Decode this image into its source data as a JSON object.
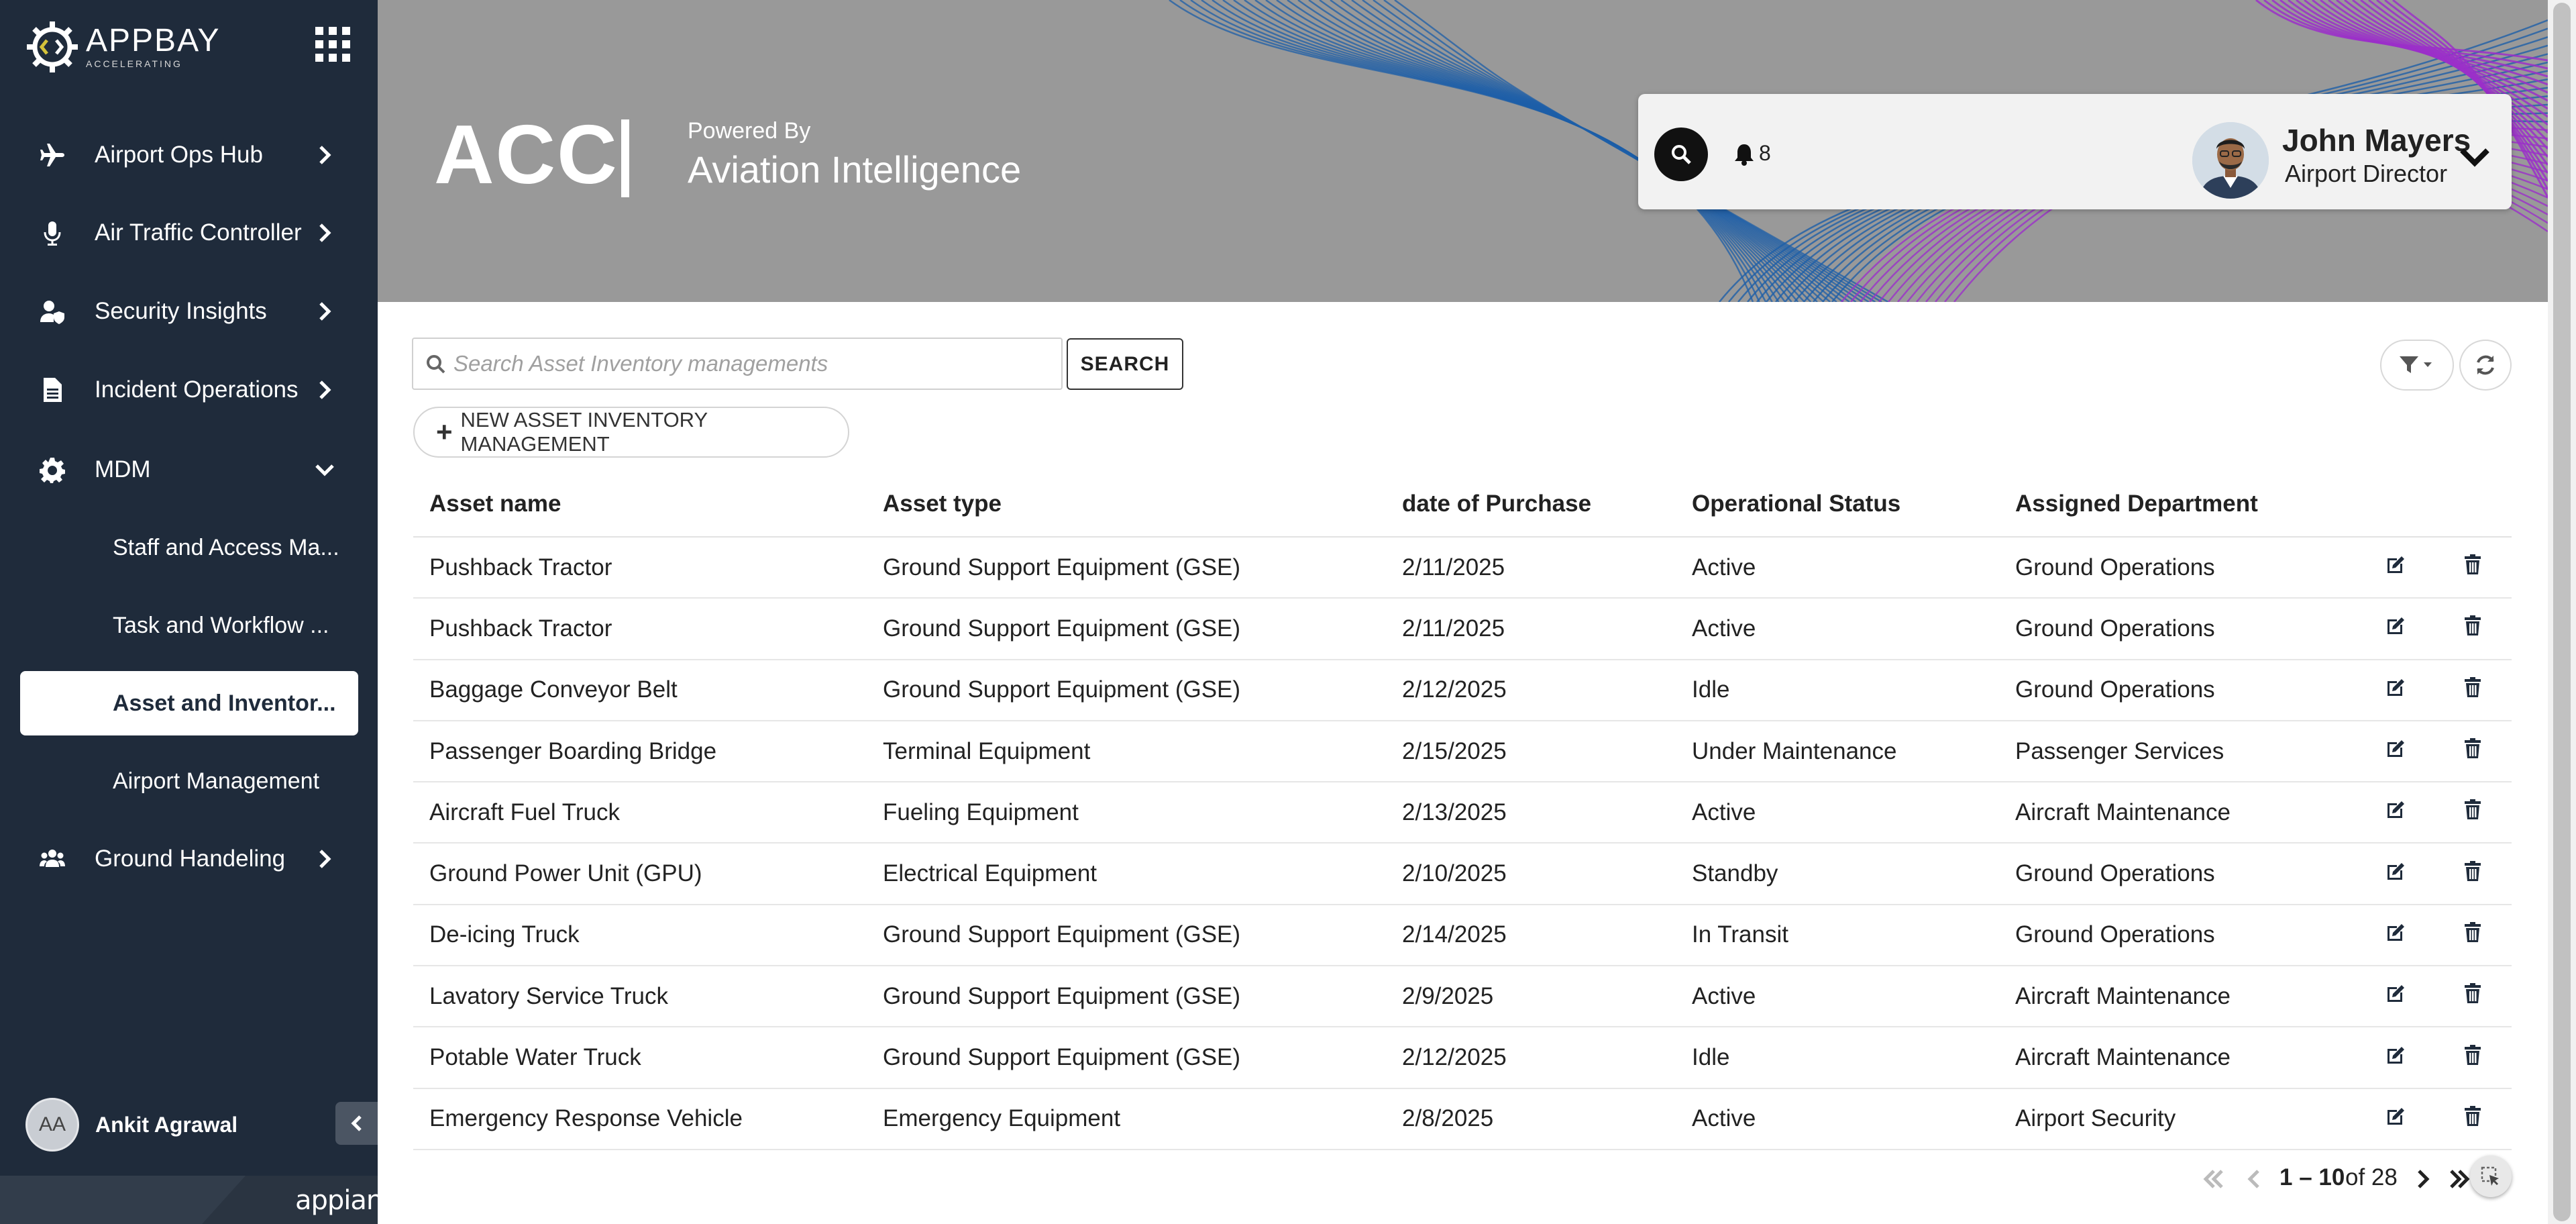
{
  "brand": {
    "name": "APPBAY",
    "tagline": "ACCELERATING"
  },
  "sidebar": {
    "items": [
      {
        "label": "Airport Ops Hub",
        "icon": "plane-icon"
      },
      {
        "label": "Air Traffic Controller",
        "icon": "microphone-icon"
      },
      {
        "label": "Security Insights",
        "icon": "user-shield-icon"
      },
      {
        "label": "Incident Operations",
        "icon": "document-icon"
      },
      {
        "label": "MDM",
        "icon": "gear-icon",
        "expanded": true
      },
      {
        "label": "Ground Handeling",
        "icon": "users-icon"
      }
    ],
    "mdm_sub_items": [
      {
        "label": "Staff and Access Ma..."
      },
      {
        "label": "Task and Workflow ..."
      },
      {
        "label": "Asset and Inventor...",
        "active": true
      },
      {
        "label": "Airport Management"
      }
    ],
    "user": {
      "initials": "AA",
      "name": "Ankit Agrawal"
    },
    "footer_logo": "appian"
  },
  "header": {
    "title": "ACC",
    "powered_by": "Powered By",
    "subtitle": "Aviation Intelligence",
    "notification_count": "8",
    "profile": {
      "name": "John Mayers",
      "role": "Airport Director"
    }
  },
  "toolbar": {
    "search_placeholder": "Search Asset Inventory managements",
    "search_value": "",
    "search_label": "SEARCH",
    "new_label": "NEW ASSET INVENTORY MANAGEMENT"
  },
  "table": {
    "columns": [
      "Asset name",
      "Asset type",
      "date of Purchase",
      "Operational Status",
      "Assigned Department"
    ],
    "rows": [
      [
        "Pushback Tractor",
        "Ground Support Equipment (GSE)",
        "2/11/2025",
        "Active",
        "Ground Operations"
      ],
      [
        "Pushback Tractor",
        "Ground Support Equipment (GSE)",
        "2/11/2025",
        "Active",
        "Ground Operations"
      ],
      [
        "Baggage Conveyor Belt",
        "Ground Support Equipment (GSE)",
        "2/12/2025",
        "Idle",
        "Ground Operations"
      ],
      [
        "Passenger Boarding Bridge",
        "Terminal Equipment",
        "2/15/2025",
        "Under Maintenance",
        "Passenger Services"
      ],
      [
        "Aircraft Fuel Truck",
        "Fueling Equipment",
        "2/13/2025",
        "Active",
        "Aircraft Maintenance"
      ],
      [
        "Ground Power Unit (GPU)",
        "Electrical Equipment",
        "2/10/2025",
        "Standby",
        "Ground Operations"
      ],
      [
        "De-icing Truck",
        "Ground Support Equipment (GSE)",
        "2/14/2025",
        "In Transit",
        "Ground Operations"
      ],
      [
        "Lavatory Service Truck",
        "Ground Support Equipment (GSE)",
        "2/9/2025",
        "Active",
        "Aircraft Maintenance"
      ],
      [
        "Potable Water Truck",
        "Ground Support Equipment (GSE)",
        "2/12/2025",
        "Idle",
        "Aircraft Maintenance"
      ],
      [
        "Emergency Response Vehicle",
        "Emergency Equipment",
        "2/8/2025",
        "Active",
        "Airport Security"
      ]
    ]
  },
  "pagination": {
    "range": "1 – 10",
    "of_text": "of 28"
  },
  "colors": {
    "sidebar_bg": "#1f2b3b",
    "banner_bg": "#999999",
    "wave_blue": "#1e5fa8",
    "wave_purple": "#9b2fc9"
  }
}
